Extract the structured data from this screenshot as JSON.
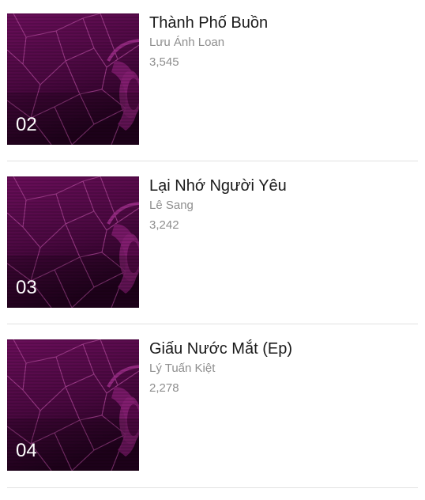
{
  "colors": {
    "thumb_bg_top": "#6b0f5c",
    "thumb_bg_bottom": "#2a0224",
    "thumb_lines": "#b54aa0",
    "divider": "#e2e2e2",
    "title": "#1a1a1a",
    "meta": "#8e8e8e"
  },
  "songs": [
    {
      "rank": "02",
      "title": "Thành Phố Buồn",
      "artist": "Lưu Ánh Loan",
      "plays": "3,545",
      "thumbnail_icon": "headphone-wolf-art-icon"
    },
    {
      "rank": "03",
      "title": "Lại Nhớ Người Yêu",
      "artist": "Lê Sang",
      "plays": "3,242",
      "thumbnail_icon": "headphone-wolf-art-icon"
    },
    {
      "rank": "04",
      "title": "Giấu Nước Mắt (Ep)",
      "artist": "Lý Tuấn Kiệt",
      "plays": "2,278",
      "thumbnail_icon": "headphone-wolf-art-icon"
    }
  ]
}
